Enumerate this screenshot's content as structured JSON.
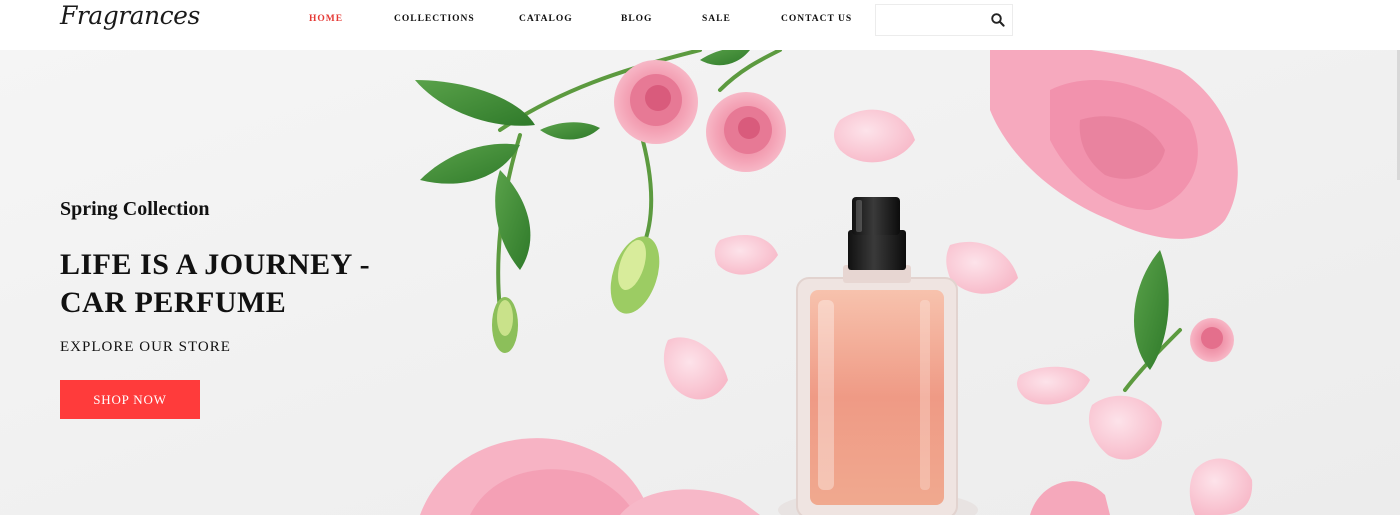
{
  "header": {
    "logo_text": "Fragrances",
    "nav": [
      {
        "label": "HOME",
        "active": true
      },
      {
        "label": "COLLECTIONS",
        "active": false
      },
      {
        "label": "CATALOG",
        "active": false
      },
      {
        "label": "BLOG",
        "active": false
      },
      {
        "label": "SALE",
        "active": false
      },
      {
        "label": "CONTACT US",
        "active": false
      }
    ],
    "search": {
      "placeholder": "",
      "value": "",
      "icon": "search-icon"
    }
  },
  "hero": {
    "subtitle": "Spring Collection",
    "headline": "LIFE IS A JOURNEY - CAR PERFUME",
    "tagline": "EXPLORE OUR STORE",
    "cta_label": "SHOP NOW"
  },
  "colors": {
    "accent": "#ff3b3b",
    "active_nav": "#e53935",
    "hero_background": "#f1f1f1",
    "text": "#111111"
  }
}
